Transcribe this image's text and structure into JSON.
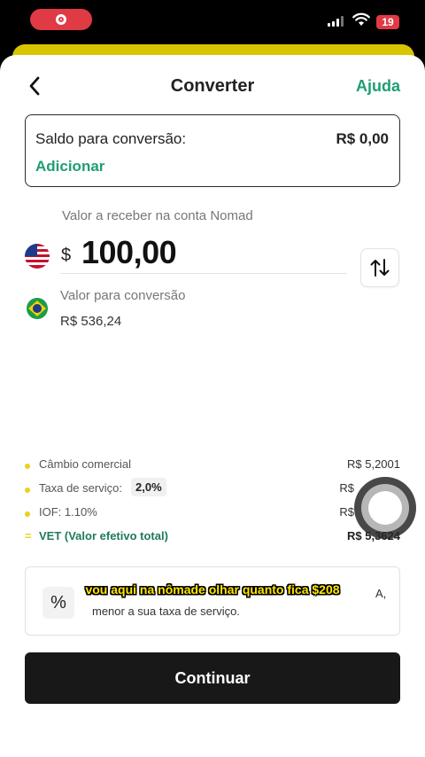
{
  "status_bar": {
    "battery": "19",
    "recording_icon": "record-icon",
    "signal_icon": "cellular-signal-icon",
    "wifi_icon": "wifi-icon"
  },
  "header": {
    "back_icon": "chevron-left-icon",
    "title": "Converter",
    "help_label": "Ajuda"
  },
  "balance": {
    "label": "Saldo para conversão:",
    "value": "R$ 0,00",
    "add_label": "Adicionar"
  },
  "receive": {
    "label": "Valor a receber na conta Nomad",
    "currency_symbol": "$",
    "amount": "100,00",
    "flag_icon": "us-flag-icon"
  },
  "swap_icon": "swap-vertical-icon",
  "conversion": {
    "label": "Valor para conversão",
    "value": "R$ 536,24",
    "flag_icon": "brazil-flag-icon"
  },
  "rates": [
    {
      "label": "Câmbio comercial",
      "value": "R$ 5,2001"
    },
    {
      "label": "Taxa de serviço:",
      "chip": "2,0%",
      "value": "R$"
    },
    {
      "label": "IOF: 1.10%",
      "value": "R$"
    },
    {
      "label": "VET (Valor efetivo total)",
      "value": "R$ 5,3624"
    }
  ],
  "info": {
    "icon": "percent-icon",
    "line1": "A,",
    "line2": "menor a sua taxa de serviço."
  },
  "caption": "vou aqui na nômade olhar quanto fica $208",
  "continue_label": "Continuar",
  "colors": {
    "accent_green": "#1f9e74",
    "rate_bullet": "#e8d21c",
    "button_bg": "#181818",
    "recording_red": "#e03a45",
    "top_strip": "#d9c400"
  }
}
